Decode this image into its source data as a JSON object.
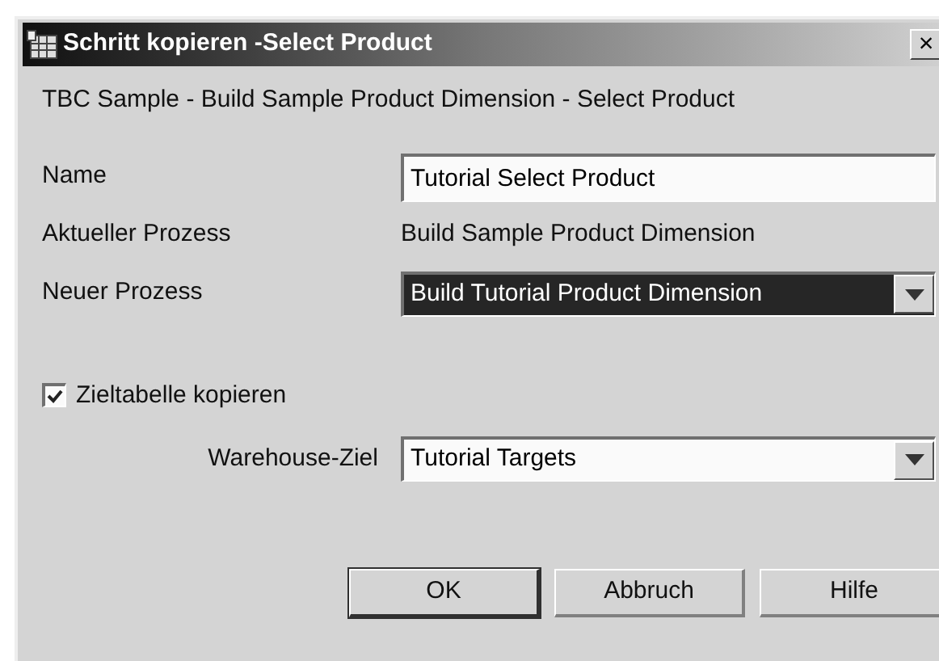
{
  "window": {
    "title": "Schritt kopieren -Select Product",
    "close": "×"
  },
  "subtitle": "TBC Sample - Build Sample Product Dimension - Select Product",
  "fields": [
    {
      "kind": "input",
      "label": "Name",
      "value": "Tutorial Select Product"
    },
    {
      "kind": "text",
      "label": "Aktueller Prozess",
      "value": "Build Sample Product Dimension"
    },
    {
      "kind": "combo",
      "label": "Neuer Prozess",
      "value": "Build Tutorial Product Dimension",
      "selected": true
    }
  ],
  "checkbox": {
    "label": "Zieltabelle kopieren",
    "checked": true
  },
  "target": {
    "label": "Warehouse-Ziel",
    "value": "Tutorial Targets",
    "selected": false
  },
  "buttons": [
    {
      "label": "OK",
      "default": true
    },
    {
      "label": "Abbruch",
      "default": false
    },
    {
      "label": "Hilfe",
      "default": false
    }
  ]
}
